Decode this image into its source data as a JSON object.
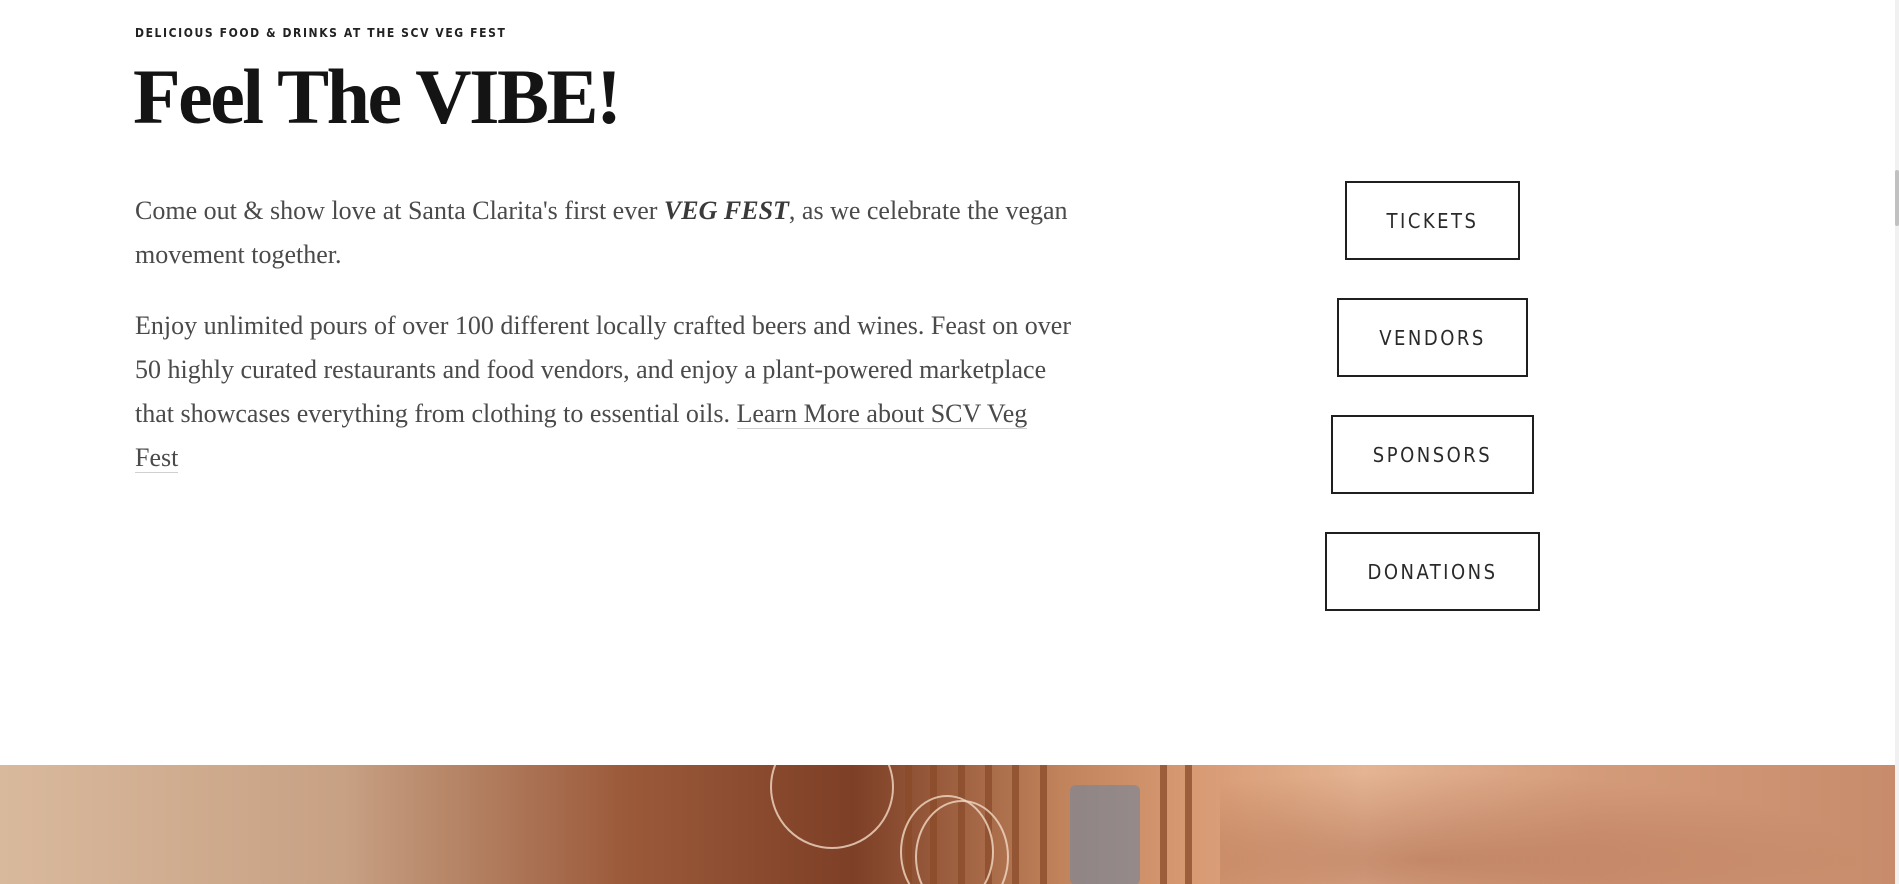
{
  "hero": {
    "eyebrow": "DELICIOUS FOOD & DRINKS AT THE SCV VEG FEST",
    "title": "Feel The VIBE!"
  },
  "intro": {
    "p1_before": "Come out & show love at Santa Clarita's first ever ",
    "p1_emphasis": "VEG FEST",
    "p1_after": ", as we celebrate the vegan movement together.",
    "p2_text": "Enjoy unlimited pours of over 100 different locally crafted beers and wines. Feast on over 50 highly curated restaurants and food vendors, and enjoy a plant-powered marketplace that showcases everything from clothing to essential oils. ",
    "p2_link": "Learn More about SCV Veg Fest"
  },
  "cta_buttons": {
    "tickets": "TICKETS",
    "vendors": "VENDORS",
    "sponsors": "SPONSORS",
    "donations": "DONATIONS"
  },
  "colors": {
    "background": "#ffffff",
    "heading": "#141414",
    "body_text": "#4a4a4a",
    "button_border": "#1f1f1f"
  }
}
